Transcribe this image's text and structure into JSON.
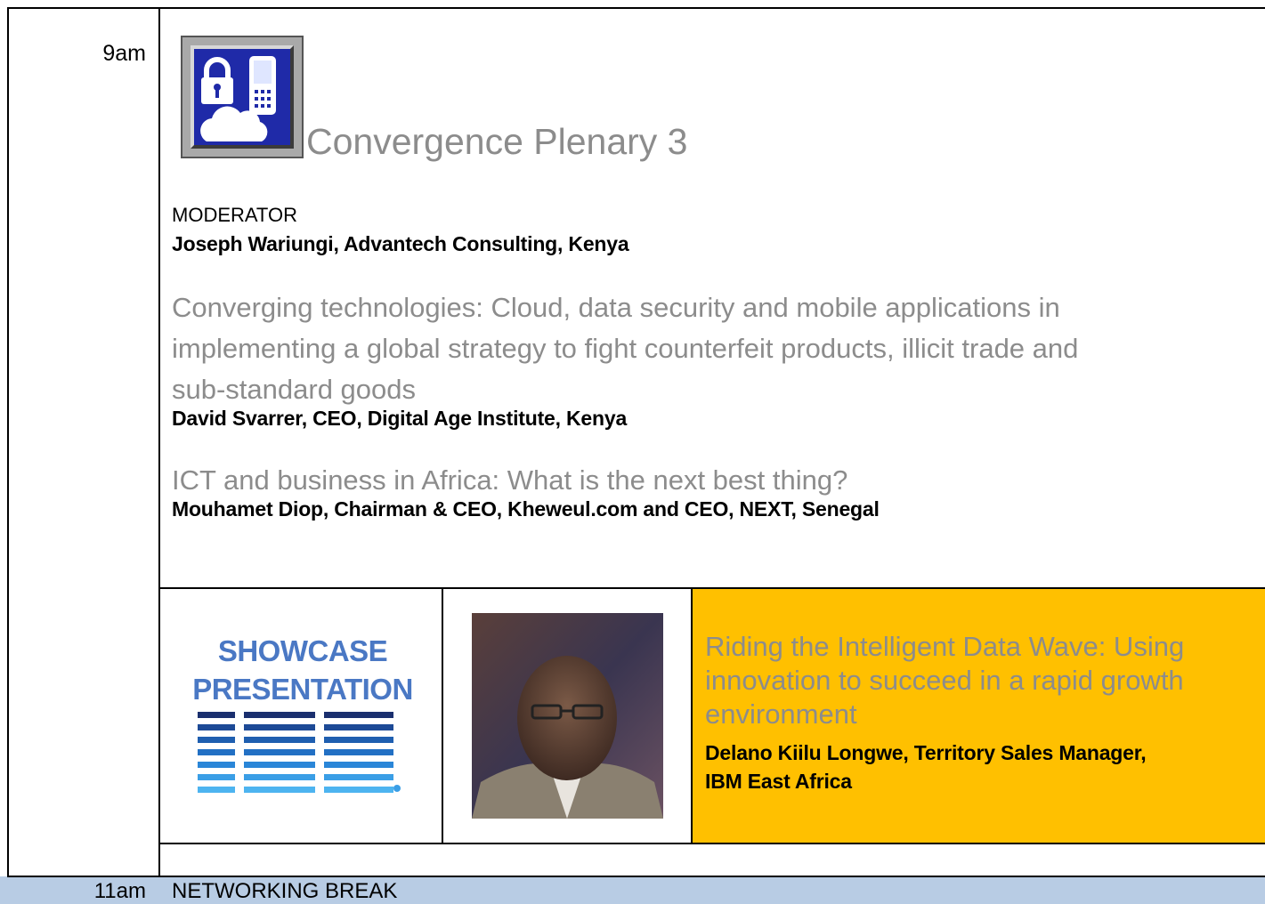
{
  "session": {
    "time": "9am",
    "icon": "security-cloud-icon",
    "title": "Convergence Plenary 3",
    "moderator_label": "MODERATOR",
    "moderator": "Joseph Wariungi, Advantech Consulting, Kenya",
    "talks": [
      {
        "title_lines": [
          "Converging technologies: Cloud, data security and mobile applications in",
          "implementing a global strategy to fight counterfeit products, illicit trade and",
          "sub-standard goods"
        ],
        "speaker": "David Svarrer, CEO, Digital Age Institute, Kenya"
      },
      {
        "title_lines": [
          "ICT and business in Africa: What is the next best thing?"
        ],
        "speaker": "Mouhamet Diop, Chairman & CEO, Kheweul.com and CEO, NEXT, Senegal"
      }
    ]
  },
  "showcase": {
    "label_lines": [
      "SHOWCASE",
      "PRESENTATION"
    ],
    "logo": "IBM",
    "photo": "speaker-portrait",
    "title_lines": [
      "Riding the Intelligent Data Wave: Using",
      "innovation to succeed in a rapid growth",
      "environment"
    ],
    "speaker_lines": [
      "Delano Kiilu Longwe, Territory Sales Manager,",
      "IBM East Africa"
    ],
    "highlight_color": "#ffc000",
    "label_color": "#4a78c4",
    "logo_color": "#1f70c1"
  },
  "break": {
    "time": "11am",
    "label": "NETWORKING BREAK",
    "color": "#b8cce4"
  }
}
